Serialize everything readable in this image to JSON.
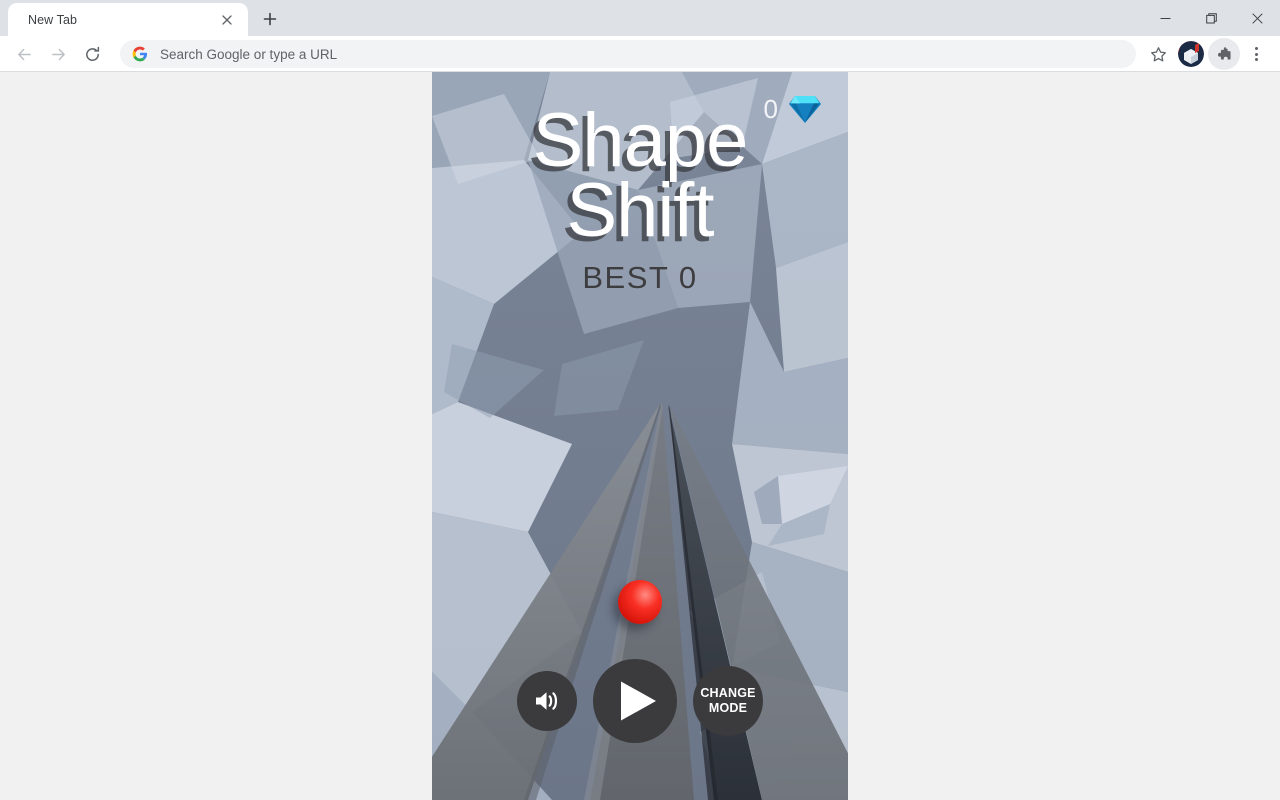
{
  "browser": {
    "tab": {
      "title": "New Tab",
      "close_icon": "close-icon",
      "favicon": "none"
    },
    "new_tab_button": {
      "icon": "plus-icon",
      "label": "New Tab"
    },
    "window_controls": [
      {
        "name": "minimize",
        "icon": "minimize-icon"
      },
      {
        "name": "maximize",
        "icon": "maximize-restore-icon"
      },
      {
        "name": "close",
        "icon": "close-icon"
      }
    ],
    "nav": {
      "back": {
        "icon": "arrow-left-icon",
        "enabled": false
      },
      "forward": {
        "icon": "arrow-right-icon",
        "enabled": false
      },
      "reload": {
        "icon": "reload-icon",
        "enabled": true
      }
    },
    "omnibox": {
      "placeholder": "Search Google or type a URL",
      "value": "",
      "leading_icon": "google-g-icon"
    },
    "toolbar_right": {
      "bookmark": {
        "icon": "star-icon"
      },
      "profile": {
        "icon": "avatar",
        "colors": [
          "#c5221f",
          "#1a2942",
          "#ffffff"
        ]
      },
      "extensions": {
        "icon": "puzzle-piece-icon"
      },
      "menu": {
        "icon": "three-dot-menu-icon"
      }
    },
    "colors": {
      "tabstrip_bg": "#dee1e6",
      "tab_active_bg": "#ffffff",
      "toolbar_bg": "#ffffff",
      "omnibox_bg": "#f1f3f4",
      "text": "#3c4043",
      "muted_text": "#5f6368",
      "page_bg": "#f1f1f1"
    }
  },
  "game": {
    "title_line_1": "Shape",
    "title_line_2": "Shift",
    "best_label": "BEST 0",
    "hud": {
      "gem_count": "0",
      "gem_icon": "diamond-gem-icon"
    },
    "player": {
      "name": "red-ball",
      "color": "#ee2017"
    },
    "buttons": {
      "sound": {
        "icon": "speaker-on-icon",
        "label": "Sound"
      },
      "play": {
        "icon": "play-triangle-icon",
        "label": "Play"
      },
      "mode": {
        "line1": "CHANGE",
        "line2": "MODE"
      }
    },
    "colors": {
      "sky": "#6e7a8c",
      "rock_light": "#cdd6e2",
      "rock_mid": "#aab6c8",
      "rock_dark": "#8b98ab",
      "road": "#6f7379",
      "road_dark": "#3a3f47",
      "button_bg": "#3b3b3d",
      "title": "#ffffff",
      "title_shadow": "#3c3e42",
      "best_text": "#3d3d3f",
      "gem": "#0f86c8"
    }
  }
}
